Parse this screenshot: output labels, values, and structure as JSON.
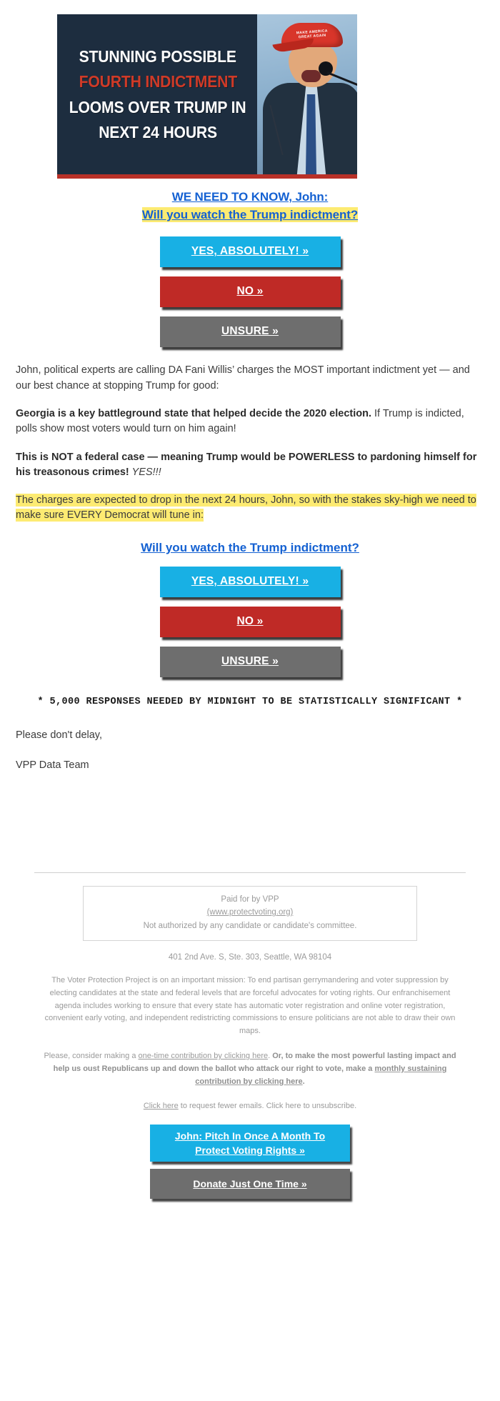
{
  "hero": {
    "alt_name": "trump-indictment-banner",
    "lines": [
      {
        "text": "STUNNING POSSIBLE",
        "accent": false
      },
      {
        "text": "FOURTH INDICTMENT",
        "accent": true
      },
      {
        "text": "LOOMS OVER TRUMP IN",
        "accent": false
      },
      {
        "text": "NEXT 24 HOURS",
        "accent": false
      }
    ],
    "cap_text": "MAKE AMERICA GREAT AGAIN",
    "bg_color": "#1d2d3f",
    "accent_color": "#cf3a27",
    "rule_color": "#b93128"
  },
  "headline": {
    "line1": "WE NEED TO KNOW, John:",
    "line2": "Will you watch the Trump indictment?",
    "link_color": "#1461d2",
    "highlight_color": "#fdeb72"
  },
  "cta": {
    "yes_label": "YES, ABSOLUTELY! »",
    "no_label": "NO »",
    "unsure_label": "UNSURE »",
    "yes_color": "#18b0e4",
    "no_color": "#bf2a26",
    "unsure_color": "#6e6e6e"
  },
  "body": {
    "p1": "John, political experts are calling DA Fani Willis’ charges the MOST important indictment yet — and our best chance at stopping Trump for good:",
    "p2_bold": "Georgia is a key battleground state that helped decide the 2020 election.",
    "p2_rest": " If Trump is indicted, polls show most voters would turn on him again!",
    "p3_bold": "This is NOT a federal case — meaning Trump would be POWERLESS to pardoning himself for his treasonous crimes!",
    "p3_italic": " YES!!!",
    "p4_highlight": "The charges are expected to drop in the next 24 hours, John, so with the stakes sky-high we need to make sure EVERY Democrat will tune in:"
  },
  "mid_link": {
    "label": "Will you watch the Trump indictment?"
  },
  "mono_note": {
    "text": "* 5,000 RESPONSES NEEDED BY MIDNIGHT TO BE STATISTICALLY SIGNIFICANT *"
  },
  "signoff": {
    "line1": "Please don't delay,",
    "line2": "VPP Data Team"
  },
  "footer": {
    "paid_for": "Paid for by VPP",
    "website": "(www.protectvoting.org)",
    "not_authorized": "Not authorized by any candidate or candidate's committee.",
    "address": "401 2nd Ave. S, Ste. 303, Seattle, WA 98104",
    "mission": "The Voter Protection Project is on an important mission: To end partisan gerrymandering and voter suppression by electing candidates at the state and federal levels that are forceful advocates for voting rights. Our enfranchisement agenda includes working to ensure that every state has automatic voter registration and online voter registration, convenient early voting, and independent redistricting commissions to ensure politicians are not able to draw their own maps.",
    "ask_pre": "Please, consider making a ",
    "ask_link1": "one-time contribution by clicking here",
    "ask_mid": ". ",
    "ask_bold": "Or, to make the most powerful lasting impact and help us oust Republicans up and down the ballot who attack our right to vote, make a ",
    "ask_link2": "monthly sustaining contribution by clicking here",
    "ask_end": ".",
    "unsub_link": "Click here",
    "unsub_rest": " to request fewer emails. Click here to unsubscribe.",
    "btn_monthly": "John: Pitch In Once A Month To Protect Voting Rights »",
    "btn_onetime": "Donate Just One Time »"
  }
}
